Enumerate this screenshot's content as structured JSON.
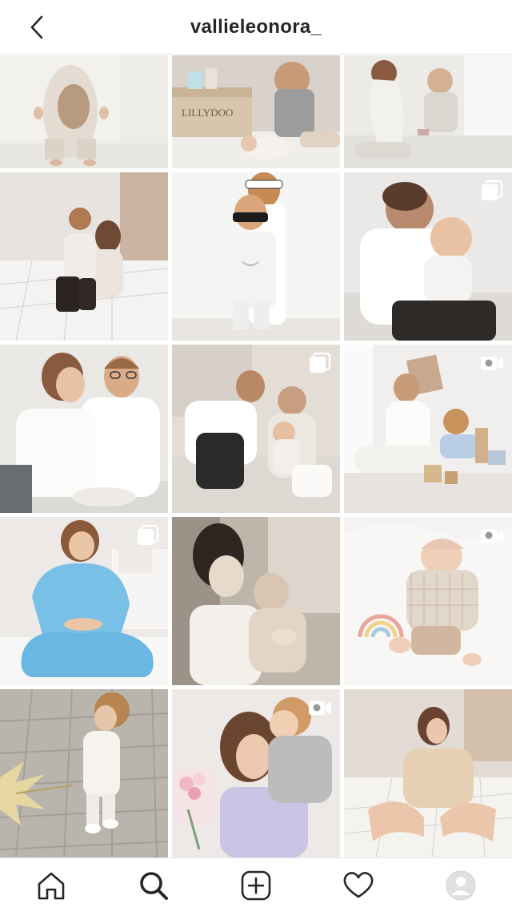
{
  "header": {
    "username": "vallieleonora_",
    "back_icon": "chevron-left-icon"
  },
  "posts": [
    {
      "id": "p1",
      "scene": "toddler in teddy costume",
      "badge": "none"
    },
    {
      "id": "p2",
      "scene": "mother with baby and LILLYDOO box",
      "badge": "none",
      "box_text": "LILLYDOO"
    },
    {
      "id": "p3",
      "scene": "mother and child by window",
      "badge": "none"
    },
    {
      "id": "p4",
      "scene": "mother and child on bed",
      "badge": "none"
    },
    {
      "id": "p5",
      "scene": "two children with sunglasses",
      "badge": "none"
    },
    {
      "id": "p6",
      "scene": "father kissing baby",
      "badge": "carousel"
    },
    {
      "id": "p7",
      "scene": "couple portrait",
      "badge": "none"
    },
    {
      "id": "p8",
      "scene": "family on bed",
      "badge": "carousel"
    },
    {
      "id": "p9",
      "scene": "mother and toddler playing with blocks",
      "badge": "video"
    },
    {
      "id": "p10",
      "scene": "woman in blue tracksuit",
      "badge": "carousel"
    },
    {
      "id": "p11",
      "scene": "sepia mother and baby",
      "badge": "none"
    },
    {
      "id": "p12",
      "scene": "sleeping baby",
      "badge": "video"
    },
    {
      "id": "p13",
      "scene": "toddler with leaf",
      "badge": "none"
    },
    {
      "id": "p14",
      "scene": "mother hugging child with flowers",
      "badge": "video"
    },
    {
      "id": "p15",
      "scene": "woman sitting on bed",
      "badge": "none"
    }
  ],
  "nav": {
    "items": [
      {
        "name": "home-icon",
        "active": false
      },
      {
        "name": "search-icon",
        "active": true
      },
      {
        "name": "add-post-icon",
        "active": false
      },
      {
        "name": "heart-icon",
        "active": false
      },
      {
        "name": "profile-avatar",
        "active": false
      }
    ]
  },
  "colors": {
    "background": "#ffffff",
    "text": "#262626",
    "divider": "#e6e6e6",
    "badge": "#ffffff"
  }
}
